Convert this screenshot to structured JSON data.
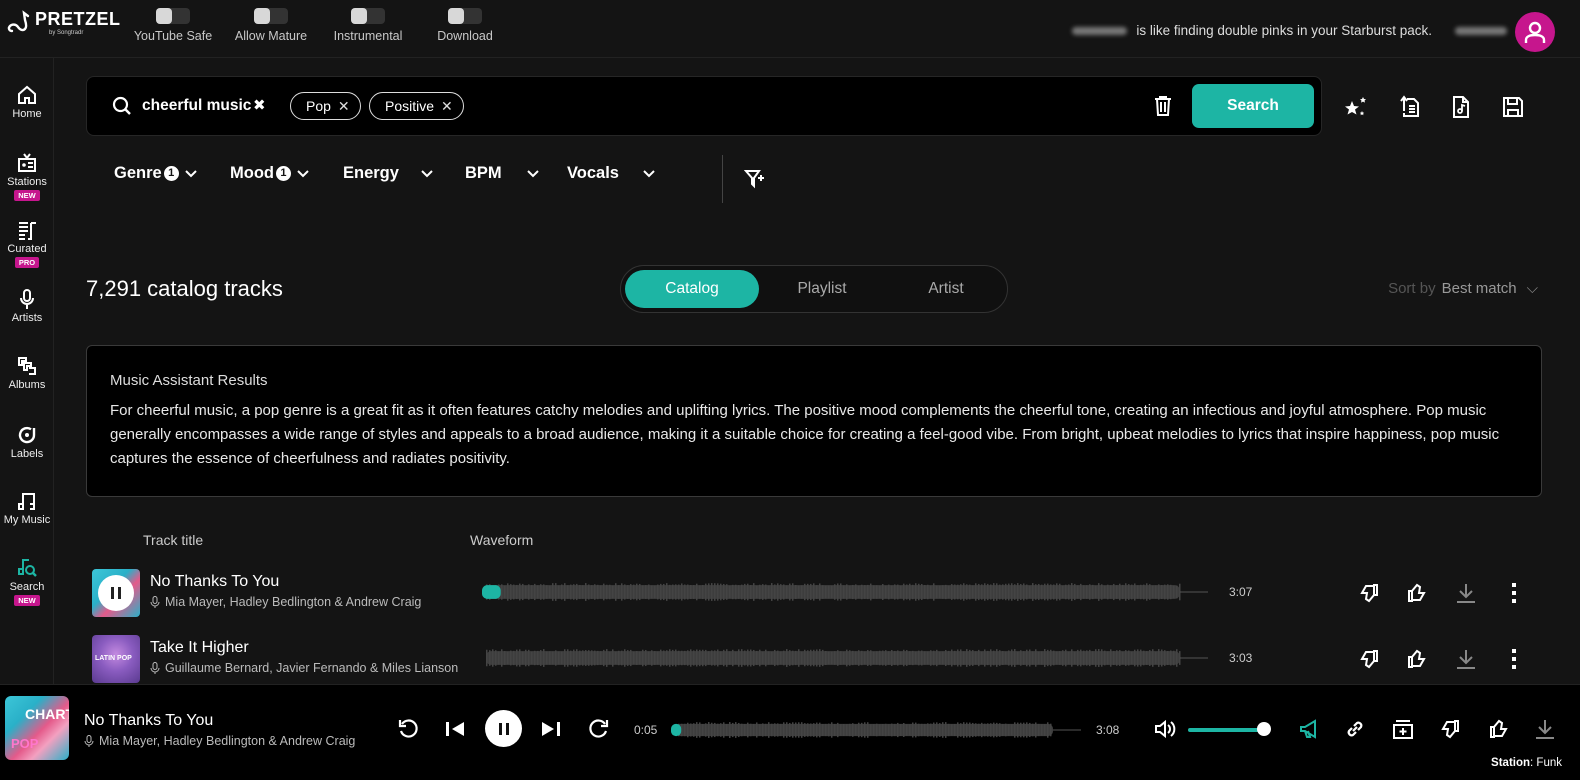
{
  "brand": {
    "name": "PRETZEL",
    "sub": "by Songtradr"
  },
  "toggles": [
    {
      "label": "YouTube Safe",
      "on": false
    },
    {
      "label": "Allow Mature",
      "on": false
    },
    {
      "label": "Instrumental",
      "on": false
    },
    {
      "label": "Download",
      "on": false
    }
  ],
  "tagline": "is like finding double pinks in your Starburst pack.",
  "sidebar": {
    "items": [
      {
        "label": "Home",
        "icon": "home-icon"
      },
      {
        "label": "Stations",
        "icon": "radio-icon",
        "badge": "NEW"
      },
      {
        "label": "Curated",
        "icon": "curated-list-icon",
        "badge": "PRO"
      },
      {
        "label": "Artists",
        "icon": "microphone-icon"
      },
      {
        "label": "Albums",
        "icon": "albums-icon"
      },
      {
        "label": "Labels",
        "icon": "label-vinyl-icon"
      },
      {
        "label": "My Music",
        "icon": "music-note-icon"
      },
      {
        "label": "Search",
        "icon": "music-search-icon",
        "badge": "NEW",
        "active": true
      }
    ]
  },
  "search": {
    "query": "cheerful music",
    "chips": [
      {
        "label": "Pop"
      },
      {
        "label": "Positive"
      }
    ],
    "button_label": "Search"
  },
  "filters": [
    {
      "label": "Genre",
      "count": "1"
    },
    {
      "label": "Mood",
      "count": "1"
    },
    {
      "label": "Energy"
    },
    {
      "label": "BPM"
    },
    {
      "label": "Vocals"
    }
  ],
  "results": {
    "count_label": "7,291 catalog tracks",
    "tabs": [
      {
        "label": "Catalog",
        "active": true
      },
      {
        "label": "Playlist"
      },
      {
        "label": "Artist"
      }
    ],
    "sort_label": "Sort by",
    "sort_value": "Best match"
  },
  "assistant": {
    "title": "Music Assistant Results",
    "body": "For cheerful music, a pop genre is a great fit as it often features catchy melodies and uplifting lyrics. The positive mood complements the cheerful tone, creating an infectious and joyful atmosphere. Pop music generally encompasses a wide range of styles and appeals to a broad audience, making it a suitable choice for creating a feel-good vibe. From bright, upbeat melodies to lyrics that inspire happiness, pop music captures the essence of cheerfulness and radiates positivity."
  },
  "table": {
    "headers": {
      "title": "Track title",
      "waveform": "Waveform"
    },
    "tracks": [
      {
        "title": "No Thanks To You",
        "artists": "Mia Mayer, Hadley Bedlington & Andrew Craig",
        "duration": "3:07",
        "playing": true,
        "progress": 0.027,
        "cover_text": "CHART POP"
      },
      {
        "title": "Take It Higher",
        "artists": "Guillaume Bernard, Javier Fernando & Miles Lianson",
        "duration": "3:03",
        "playing": false,
        "progress": 0,
        "cover_text": "LATIN POP"
      }
    ]
  },
  "player": {
    "title": "No Thanks To You",
    "artists": "Mia Mayer, Hadley Bedlington & Andrew Craig",
    "elapsed": "0:05",
    "total": "3:08",
    "progress": 0.027,
    "volume": 1.0,
    "station_label": "Station",
    "station_value": "Funk"
  },
  "colors": {
    "accent": "#1db5a4",
    "brand": "#c6168d",
    "background": "#141414"
  }
}
